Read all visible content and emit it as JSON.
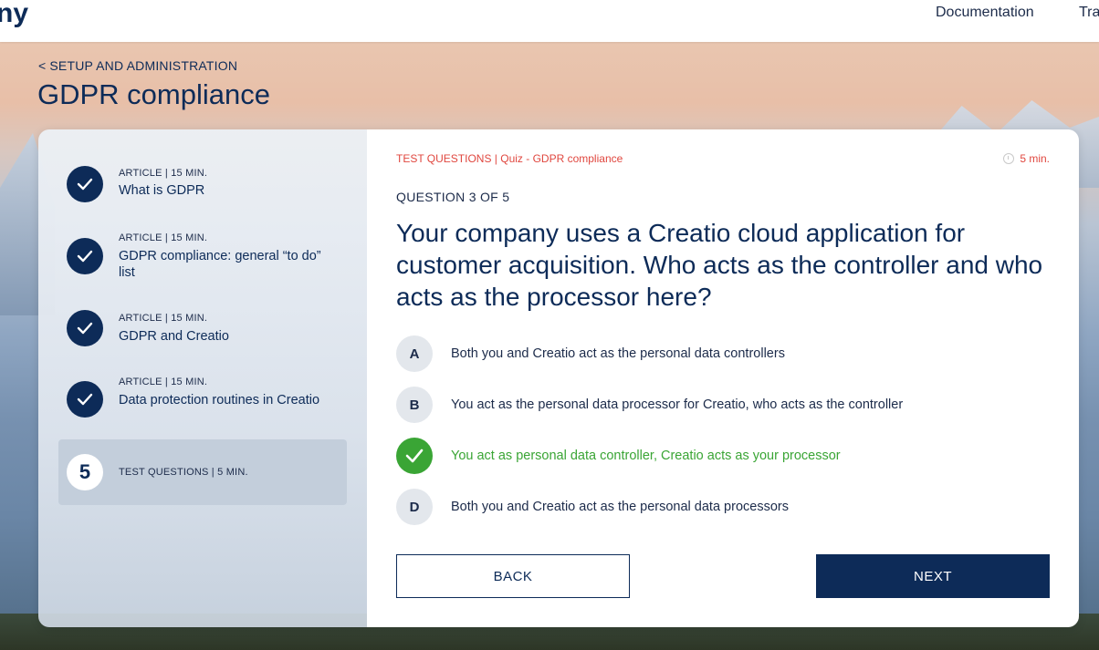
{
  "header": {
    "logo_fragment": "ny",
    "nav": [
      "Documentation",
      "Tra"
    ]
  },
  "breadcrumb": {
    "chevron": "<",
    "label": "SETUP AND ADMINISTRATION"
  },
  "page_title": "GDPR compliance",
  "sidebar": {
    "steps": [
      {
        "meta": "ARTICLE | 15 MIN.",
        "title": "What is GDPR",
        "status": "completed",
        "icon": "check-icon"
      },
      {
        "meta": "ARTICLE | 15 MIN.",
        "title": "GDPR compliance: general “to do” list",
        "status": "completed",
        "icon": "check-icon"
      },
      {
        "meta": "ARTICLE | 15 MIN.",
        "title": "GDPR and Creatio",
        "status": "completed",
        "icon": "check-icon"
      },
      {
        "meta": "ARTICLE | 15 MIN.",
        "title": "Data protection routines in Creatio",
        "status": "completed",
        "icon": "check-icon"
      },
      {
        "number": "5",
        "meta": "TEST QUESTIONS | 5 MIN.",
        "status": "active"
      }
    ]
  },
  "quiz": {
    "meta": "TEST QUESTIONS | Quiz - GDPR compliance",
    "time": "5 min.",
    "counter": "QUESTION 3 OF 5",
    "question": "Your company uses a Creatio cloud application for customer acquisition. Who acts as the controller and who acts as the processor here?",
    "options": [
      {
        "letter": "A",
        "text": "Both you and Creatio act as the personal data controllers",
        "state": "default"
      },
      {
        "letter": "B",
        "text": "You act as the personal data processor for Creatio, who acts as the controller",
        "state": "default"
      },
      {
        "letter": "",
        "text": "You act as personal data controller, Creatio acts as your processor",
        "state": "correct"
      },
      {
        "letter": "D",
        "text": "Both you and Creatio act as the personal data processors",
        "state": "default"
      }
    ],
    "back_label": "BACK",
    "next_label": "NEXT"
  },
  "colors": {
    "primary": "#0d2b58",
    "accent_red": "#e0473f",
    "correct_green": "#3aa535"
  }
}
